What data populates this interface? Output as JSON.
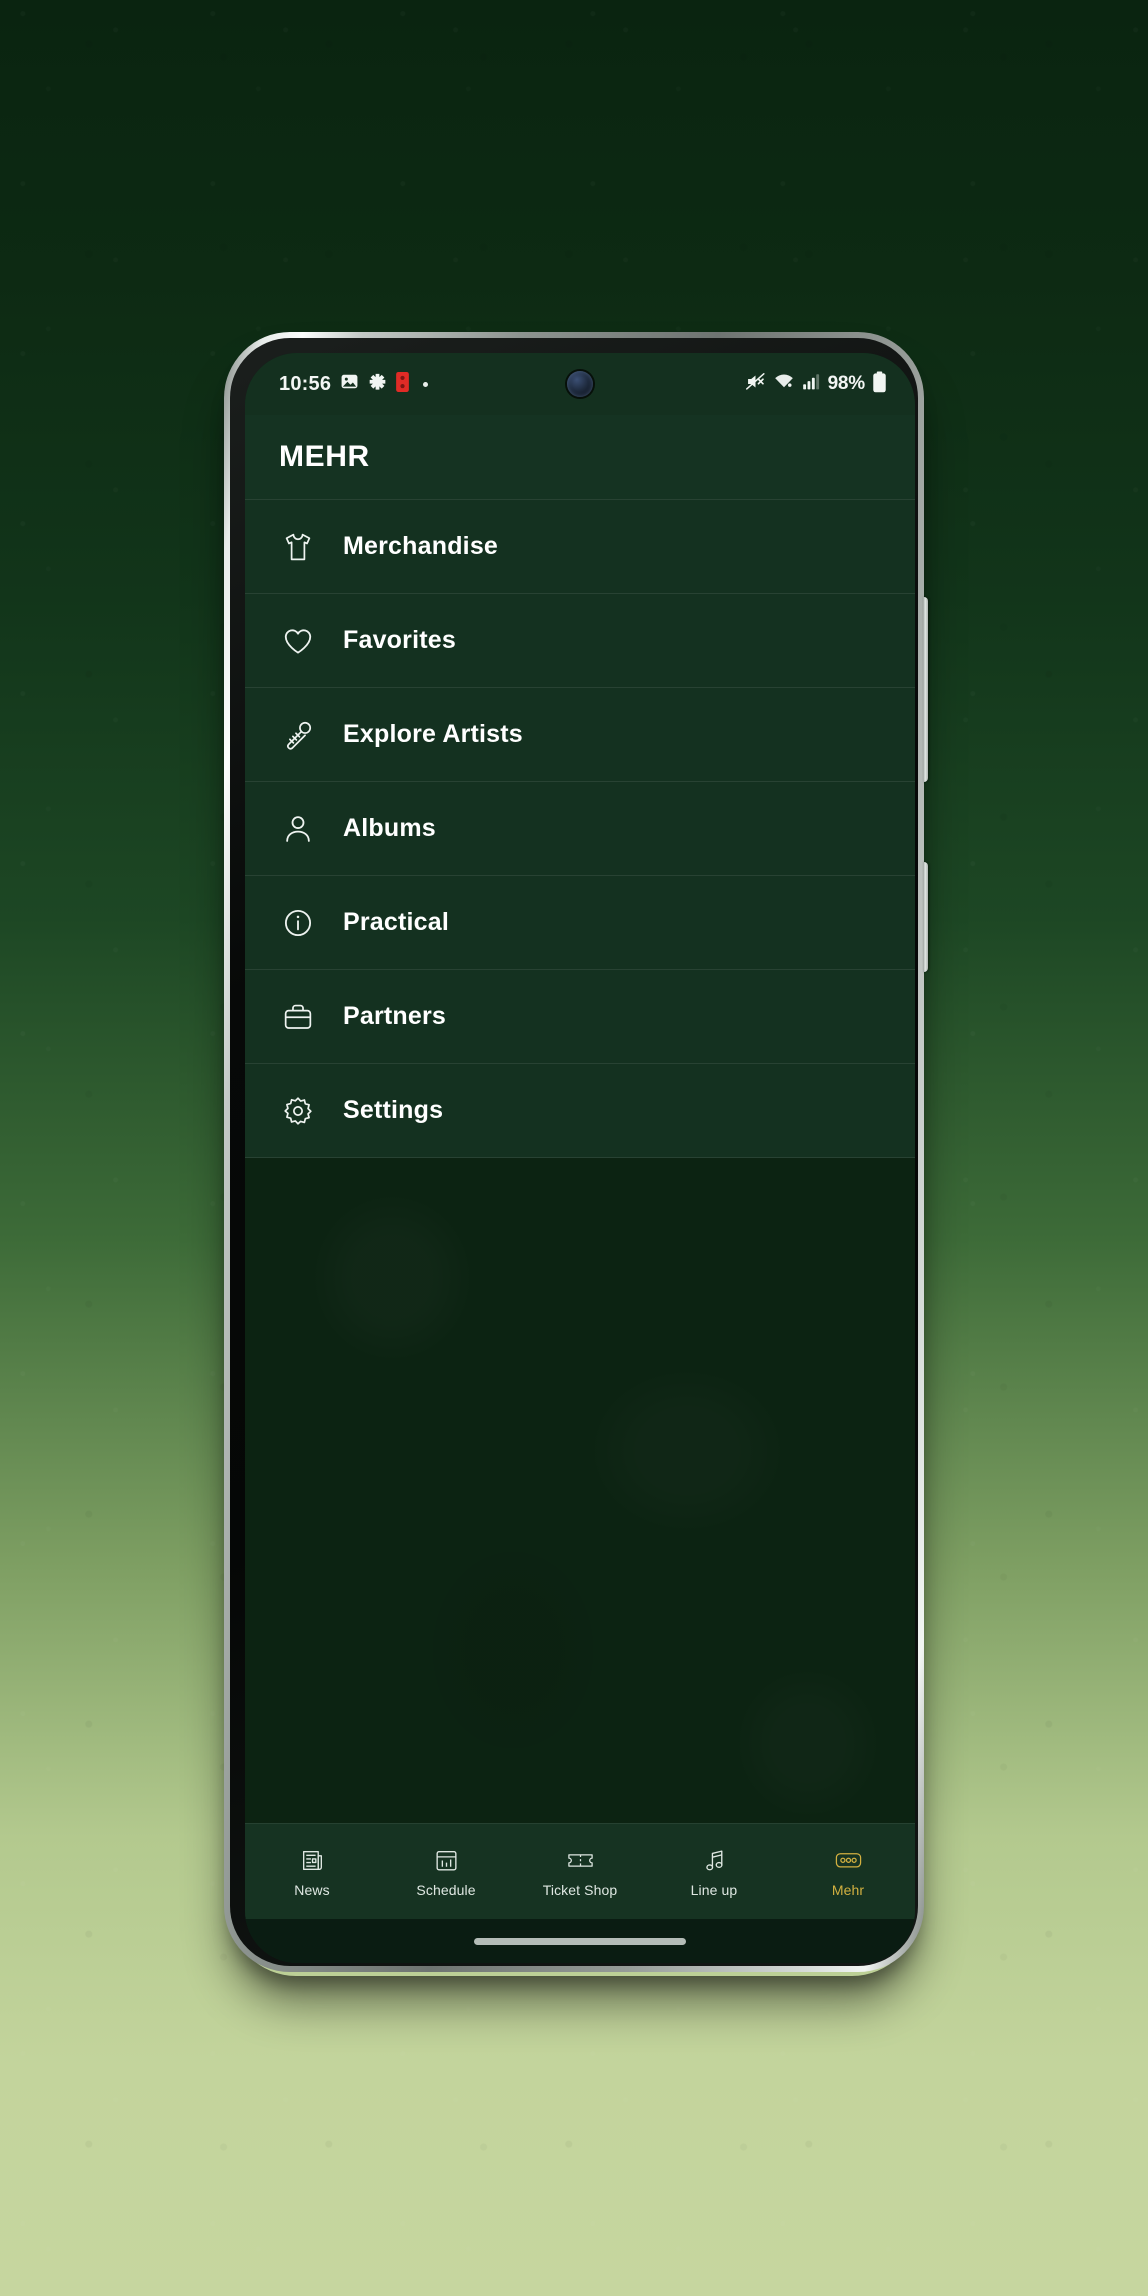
{
  "status_bar": {
    "time": "10:56",
    "battery_percent": "98%",
    "left_icons": [
      "gallery-icon",
      "clover-icon",
      "red-notification-icon",
      "small-dot-icon"
    ],
    "right_icons": [
      "mute-icon",
      "wifi-icon",
      "cellular-signal-icon",
      "battery-icon"
    ]
  },
  "header": {
    "title": "MEHR"
  },
  "menu": {
    "items": [
      {
        "label": "Merchandise",
        "icon": "tshirt-icon"
      },
      {
        "label": "Favorites",
        "icon": "heart-icon"
      },
      {
        "label": "Explore Artists",
        "icon": "microphone-icon"
      },
      {
        "label": "Albums",
        "icon": "person-icon"
      },
      {
        "label": "Practical",
        "icon": "info-circle-icon"
      },
      {
        "label": "Partners",
        "icon": "briefcase-icon"
      },
      {
        "label": "Settings",
        "icon": "gear-icon"
      }
    ]
  },
  "bottom_nav": {
    "tabs": [
      {
        "label": "News",
        "icon": "newspaper-icon",
        "active": false
      },
      {
        "label": "Schedule",
        "icon": "calendar-icon",
        "active": false
      },
      {
        "label": "Ticket Shop",
        "icon": "ticket-icon",
        "active": false
      },
      {
        "label": "Line up",
        "icon": "music-note-icon",
        "active": false
      },
      {
        "label": "Mehr",
        "icon": "more-dots-icon",
        "active": true
      }
    ]
  },
  "colors": {
    "accent": "#d2b040",
    "app_background": "#143120",
    "content_background": "#0c2312",
    "text_primary": "#ffffff",
    "backdrop_top": "#0a2410",
    "backdrop_bottom": "#c6d69f"
  }
}
